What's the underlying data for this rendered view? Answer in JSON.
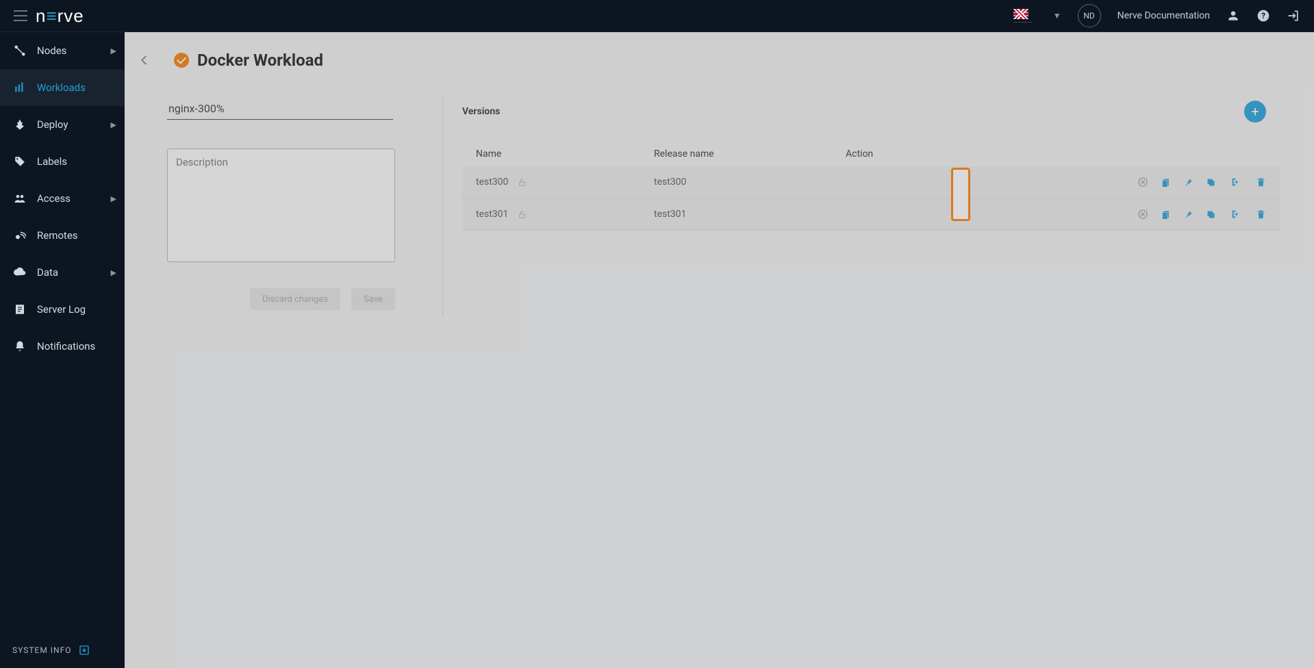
{
  "topbar": {
    "avatar_initials": "ND",
    "doc_link_label": "Nerve Documentation"
  },
  "sidebar": {
    "items": [
      {
        "label": "Nodes",
        "icon": "nodes",
        "expandable": true
      },
      {
        "label": "Workloads",
        "icon": "workloads",
        "expandable": false,
        "active": true
      },
      {
        "label": "Deploy",
        "icon": "deploy",
        "expandable": true
      },
      {
        "label": "Labels",
        "icon": "labels",
        "expandable": false
      },
      {
        "label": "Access",
        "icon": "access",
        "expandable": true
      },
      {
        "label": "Remotes",
        "icon": "remotes",
        "expandable": false
      },
      {
        "label": "Data",
        "icon": "data",
        "expandable": true
      },
      {
        "label": "Server Log",
        "icon": "serverlog",
        "expandable": false
      },
      {
        "label": "Notifications",
        "icon": "notifications",
        "expandable": false
      }
    ],
    "system_info_label": "SYSTEM INFO"
  },
  "page": {
    "title": "Docker Workload",
    "name_value": "nginx-300%",
    "description_placeholder": "Description",
    "discard_label": "Discard changes",
    "save_label": "Save"
  },
  "versions": {
    "title": "Versions",
    "columns": {
      "name": "Name",
      "release": "Release name",
      "action": "Action"
    },
    "rows": [
      {
        "name": "test300",
        "release": "test300"
      },
      {
        "name": "test301",
        "release": "test301"
      }
    ]
  }
}
